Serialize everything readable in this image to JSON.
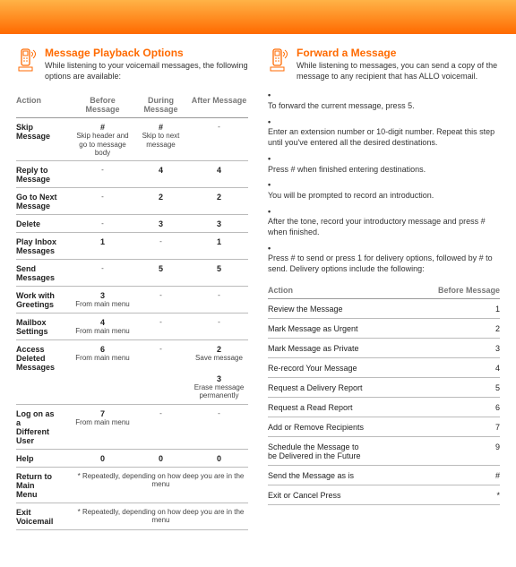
{
  "left": {
    "title": "Message Playback Options",
    "subtitle": "While listening to your voicemail messages, the following options are available:",
    "headers": [
      "Action",
      "Before Message",
      "During Message",
      "After Message"
    ],
    "rows": [
      {
        "action": "Skip Message",
        "cells": [
          {
            "main": "#",
            "sub": "Skip header and go to message body"
          },
          {
            "main": "#",
            "sub": "Skip to next message"
          },
          {
            "main": "",
            "sub": "-"
          }
        ]
      },
      {
        "action": "Reply to Message",
        "cells": [
          {
            "main": "",
            "sub": "-"
          },
          {
            "main": "4"
          },
          {
            "main": "4"
          }
        ]
      },
      {
        "action": "Go to Next Message",
        "cells": [
          {
            "main": "",
            "sub": "-"
          },
          {
            "main": "2"
          },
          {
            "main": "2"
          }
        ]
      },
      {
        "action": "Delete",
        "cells": [
          {
            "main": "",
            "sub": "-"
          },
          {
            "main": "3"
          },
          {
            "main": "3"
          }
        ]
      },
      {
        "action": "Play Inbox Messages",
        "cells": [
          {
            "main": "1"
          },
          {
            "main": "",
            "sub": "-"
          },
          {
            "main": "1"
          }
        ]
      },
      {
        "action": "Send Messages",
        "cells": [
          {
            "main": "",
            "sub": "-"
          },
          {
            "main": "5"
          },
          {
            "main": "5"
          }
        ]
      },
      {
        "action": "Work with Greetings",
        "cells": [
          {
            "main": "3",
            "sub": "From main menu"
          },
          {
            "main": "",
            "sub": "-"
          },
          {
            "main": "",
            "sub": "-"
          }
        ]
      },
      {
        "action": "Mailbox Settings",
        "cells": [
          {
            "main": "4",
            "sub": "From main menu"
          },
          {
            "main": "",
            "sub": "-"
          },
          {
            "main": "",
            "sub": "-"
          }
        ]
      },
      {
        "action": "Access Deleted Messages",
        "cells": [
          {
            "main": "6",
            "sub": "From main menu"
          },
          {
            "main": "",
            "sub": "-"
          },
          {
            "main": "2",
            "sub": "Save message",
            "extra": "3",
            "extraSub": "Erase message permanently"
          }
        ]
      },
      {
        "action": "Log on as a Different User",
        "cells": [
          {
            "main": "7",
            "sub": "From main menu"
          },
          {
            "main": "",
            "sub": "-"
          },
          {
            "main": "",
            "sub": "-"
          }
        ]
      },
      {
        "action": "Help",
        "cells": [
          {
            "main": "0"
          },
          {
            "main": "0"
          },
          {
            "main": "0"
          }
        ]
      },
      {
        "action": "Return to Main Menu",
        "span": "* Repeatedly, depending on how deep you are in the menu"
      },
      {
        "action": "Exit Voicemail",
        "span": "* Repeatedly, depending on how deep you are in the menu"
      }
    ]
  },
  "right": {
    "title": "Forward a Message",
    "subtitle": "While listening to messages, you can send a copy of the message to any recipient that has ALLO voicemail.",
    "bullets": [
      "To forward the current message, press 5.",
      "Enter an extension number or 10-digit number. Repeat this step until you've entered all the desired destinations.",
      "Press # when finished entering destinations.",
      "You will be prompted to record an introduction.",
      "After the tone, record your introductory message and press # when finished.",
      "Press # to send or press 1 for delivery options, followed by # to send. Delivery options include the following:"
    ],
    "tableHead": [
      "Action",
      "Before Message"
    ],
    "rows2": [
      [
        "Review the Message",
        "1"
      ],
      [
        "Mark Message as Urgent",
        "2"
      ],
      [
        "Mark Message as Private",
        "3"
      ],
      [
        "Re-record Your Message",
        "4"
      ],
      [
        "Request a Delivery Report",
        "5"
      ],
      [
        "Request a Read Report",
        "6"
      ],
      [
        "Add or Remove Recipients",
        "7"
      ],
      [
        "Schedule the Message to be Delivered in the Future",
        "9"
      ],
      [
        "Send the Message as is",
        "#"
      ],
      [
        "Exit or Cancel Press",
        "*"
      ]
    ]
  }
}
